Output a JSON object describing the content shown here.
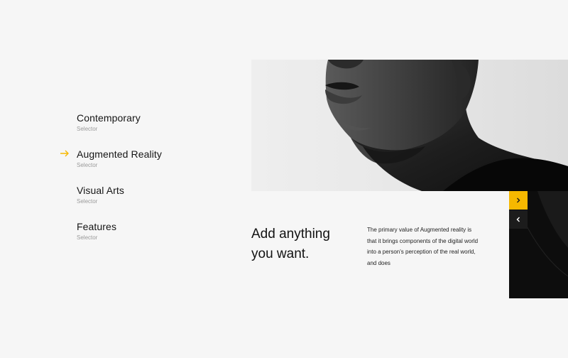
{
  "nav": {
    "items": [
      {
        "title": "Contemporary",
        "subtitle": "Selector",
        "active": false
      },
      {
        "title": "Augmented Reality",
        "subtitle": "Selector",
        "active": true
      },
      {
        "title": "Visual Arts",
        "subtitle": "Selector",
        "active": false
      },
      {
        "title": "Features",
        "subtitle": "Selector",
        "active": false
      }
    ]
  },
  "content": {
    "headline_line1": "Add anything",
    "headline_line2": "you want.",
    "body": "The primary value of Augmented reality is that it brings components of the digital world into a person's perception of the real world, and does"
  },
  "controls": {
    "next_icon": "chevron-right-icon",
    "prev_icon": "chevron-left-icon"
  },
  "colors": {
    "accent": "#f6b800",
    "dark": "#1c1c1c",
    "background": "#f6f6f6"
  }
}
